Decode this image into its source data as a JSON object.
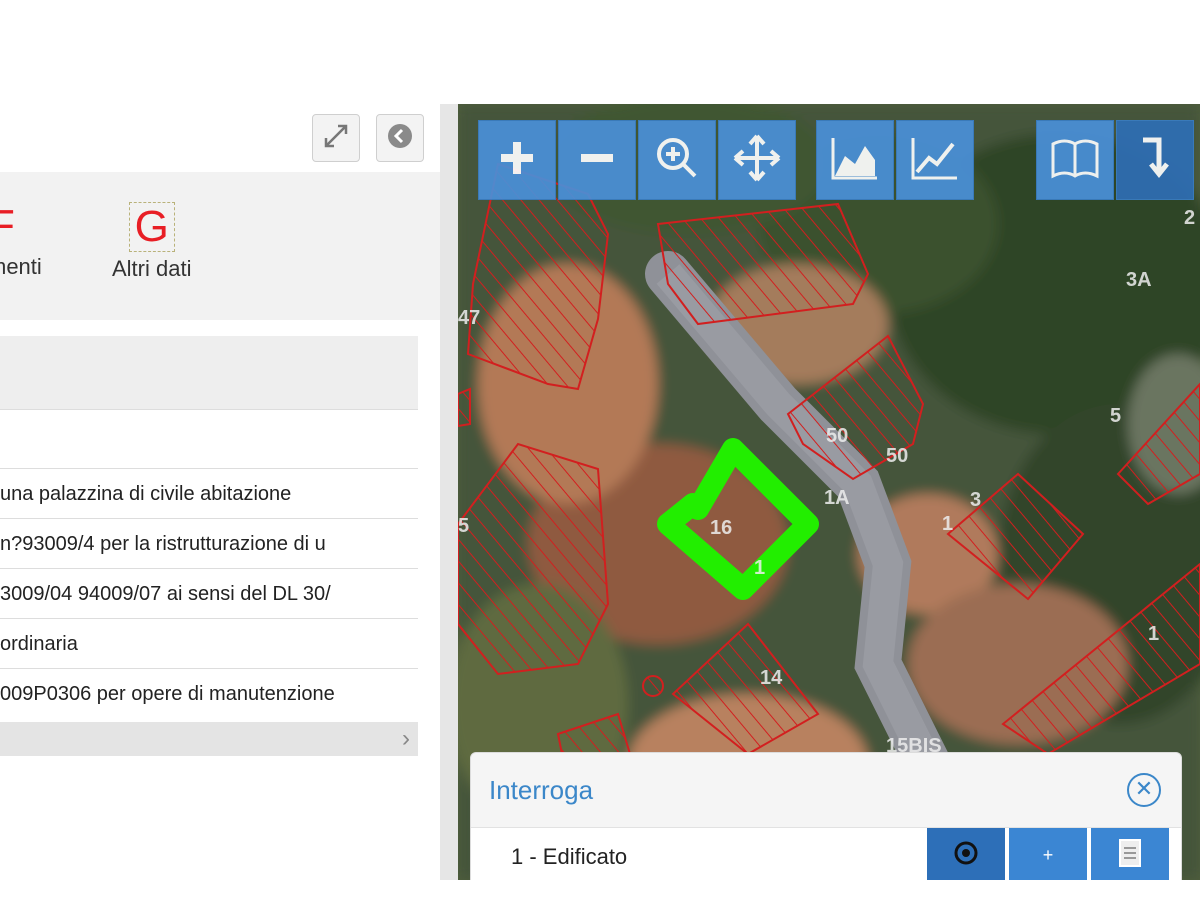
{
  "tabs": [
    {
      "letter": "F",
      "label": "menti"
    },
    {
      "letter": "G",
      "label": "Altri dati"
    }
  ],
  "rows": [
    "una palazzina di civile abitazione",
    "n?93009/4 per la ristrutturazione di u",
    "3009/04 94009/07 ai sensi del DL 30/",
    "ordinaria",
    "009P0306 per opere di manutenzione"
  ],
  "map": {
    "labels": [
      "47",
      "3A",
      "5",
      "50",
      "50",
      "3",
      "1",
      "1A",
      "1",
      "1",
      "14",
      "15BIS",
      "5",
      "2",
      "16"
    ]
  },
  "toolbar": {
    "tools": [
      "zoom-in",
      "zoom-out",
      "zoom-box",
      "pan",
      "area-profile",
      "line-profile",
      "legend",
      "download"
    ]
  },
  "interroga": {
    "title": "Interroga",
    "layer": "1 - Edificato",
    "plus_label": "+"
  },
  "colors": {
    "accent": "#3b87c9",
    "tool_blue": "#4a90d9",
    "highlight": "#22ee00",
    "parcel_red": "#d21f1f",
    "tab_letter": "#e81e25"
  }
}
